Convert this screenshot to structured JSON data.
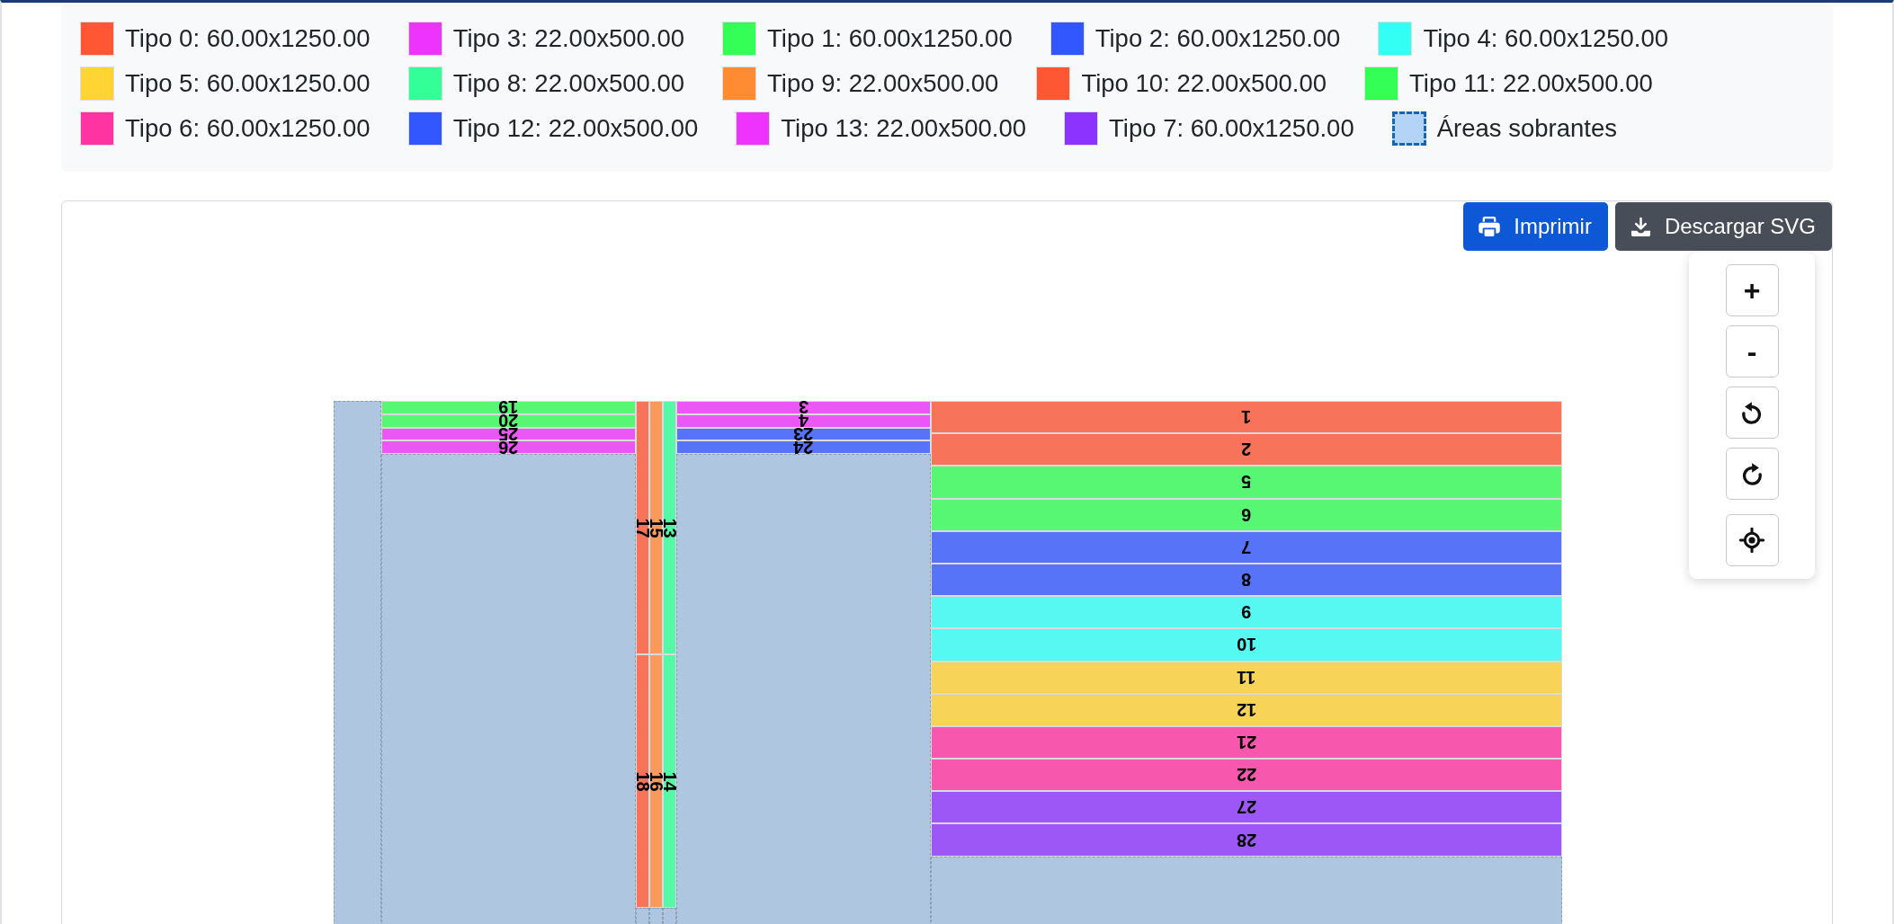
{
  "legend_rows": [
    [
      {
        "kind": "type",
        "color": "#ff5733",
        "label": "Tipo 0: 60.00x1250.00"
      },
      {
        "kind": "type",
        "color": "#ee33ff",
        "label": "Tipo 3: 22.00x500.00"
      },
      {
        "kind": "type",
        "color": "#33ff57",
        "label": "Tipo 1: 60.00x1250.00"
      },
      {
        "kind": "type",
        "color": "#3357ff",
        "label": "Tipo 2: 60.00x1250.00"
      },
      {
        "kind": "type",
        "color": "#33fff5",
        "label": "Tipo 4: 60.00x1250.00"
      }
    ],
    [
      {
        "kind": "type",
        "color": "#ffd433",
        "label": "Tipo 5: 60.00x1250.00"
      },
      {
        "kind": "type",
        "color": "#33ff99",
        "label": "Tipo 8: 22.00x500.00"
      },
      {
        "kind": "type",
        "color": "#ff8c33",
        "label": "Tipo 9: 22.00x500.00"
      },
      {
        "kind": "type",
        "color": "#ff5733",
        "label": "Tipo 10: 22.00x500.00"
      },
      {
        "kind": "type",
        "color": "#33ff57",
        "label": "Tipo 11: 22.00x500.00"
      }
    ],
    [
      {
        "kind": "type",
        "color": "#ff33a1",
        "label": "Tipo 6: 60.00x1250.00"
      },
      {
        "kind": "type",
        "color": "#3357ff",
        "label": "Tipo 12: 22.00x500.00"
      },
      {
        "kind": "type",
        "color": "#ee33ff",
        "label": "Tipo 13: 22.00x500.00"
      },
      {
        "kind": "type",
        "color": "#8c33ff",
        "label": "Tipo 7: 60.00x1250.00"
      },
      {
        "kind": "offcut",
        "color": "#b3d4f7",
        "label": "Áreas sobrantes"
      }
    ]
  ],
  "toolbar": [
    {
      "kind": "print",
      "label": "Imprimir"
    },
    {
      "kind": "download",
      "label": "Descargar SVG"
    }
  ],
  "zoom_controls": [
    {
      "kind": "zoom_in",
      "label": "+"
    },
    {
      "kind": "zoom_out",
      "label": "-"
    },
    {
      "kind": "rotate_left"
    },
    {
      "kind": "rotate_right"
    },
    {
      "kind": "center"
    }
  ],
  "sheet": {
    "columns": [
      {
        "kind": "offcut"
      },
      {
        "kind": "narrow_rows",
        "offcut_below": true,
        "pieces": [
          {
            "label": "19",
            "color": "#57f773"
          },
          {
            "label": "20",
            "color": "#57f773"
          },
          {
            "label": "25",
            "color": "#ea57f5"
          },
          {
            "label": "26",
            "color": "#ea57f5"
          }
        ]
      },
      {
        "kind": "strip",
        "offcut_below": true,
        "pieces": [
          {
            "label": "17",
            "color": "#f7735a"
          },
          {
            "label": "18",
            "color": "#f7735a"
          }
        ]
      },
      {
        "kind": "strip",
        "offcut_below": true,
        "pieces": [
          {
            "label": "15",
            "color": "#f79a5c"
          },
          {
            "label": "16",
            "color": "#f79a5c"
          }
        ]
      },
      {
        "kind": "strip",
        "offcut_below": true,
        "pieces": [
          {
            "label": "13",
            "color": "#57f7a8"
          },
          {
            "label": "14",
            "color": "#57f7a8"
          }
        ]
      },
      {
        "kind": "narrow_rows",
        "offcut_below": true,
        "pieces": [
          {
            "label": "3",
            "color": "#ea57f5"
          },
          {
            "label": "4",
            "color": "#ea57f5"
          },
          {
            "label": "23",
            "color": "#5773f7"
          },
          {
            "label": "24",
            "color": "#5773f7"
          }
        ]
      },
      {
        "kind": "wide_rows",
        "offcut_below": true,
        "pieces": [
          {
            "label": "1",
            "color": "#f7735a"
          },
          {
            "label": "2",
            "color": "#f7735a"
          },
          {
            "label": "5",
            "color": "#57f773"
          },
          {
            "label": "6",
            "color": "#57f773"
          },
          {
            "label": "7",
            "color": "#5773f7"
          },
          {
            "label": "8",
            "color": "#5773f7"
          },
          {
            "label": "9",
            "color": "#57f7f2"
          },
          {
            "label": "10",
            "color": "#57f7f2"
          },
          {
            "label": "11",
            "color": "#f7d357"
          },
          {
            "label": "12",
            "color": "#f7d357"
          },
          {
            "label": "21",
            "color": "#f757ad"
          },
          {
            "label": "22",
            "color": "#f757ad"
          },
          {
            "label": "27",
            "color": "#9d57f7"
          },
          {
            "label": "28",
            "color": "#9d57f7"
          }
        ]
      }
    ]
  }
}
